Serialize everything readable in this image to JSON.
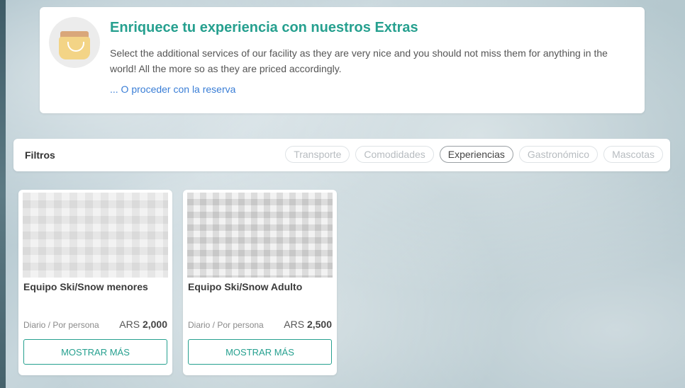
{
  "hero": {
    "title": "Enriquece tu experiencia con nuestros Extras",
    "description": "Select the additional services of our facility as they are very nice and you should not miss them for anything in the world! All the more so as they are priced accordingly.",
    "link_label": "... O proceder con la reserva",
    "icon": "jar-icon"
  },
  "filters": {
    "label": "Filtros",
    "chips": [
      {
        "label": "Transporte",
        "active": false
      },
      {
        "label": "Comodidades",
        "active": false
      },
      {
        "label": "Experiencias",
        "active": true
      },
      {
        "label": "Gastronómico",
        "active": false
      },
      {
        "label": "Mascotas",
        "active": false
      }
    ]
  },
  "products": [
    {
      "title": "Equipo Ski/Snow menores",
      "unit": "Diario / Por persona",
      "currency": "ARS",
      "price": "2,000",
      "button_label": "MOSTRAR MÁS"
    },
    {
      "title": "Equipo Ski/Snow Adulto",
      "unit": "Diario / Por persona",
      "currency": "ARS",
      "price": "2,500",
      "button_label": "MOSTRAR MÁS"
    }
  ],
  "colors": {
    "accent": "#26a08f",
    "link": "#3a7ed6"
  }
}
